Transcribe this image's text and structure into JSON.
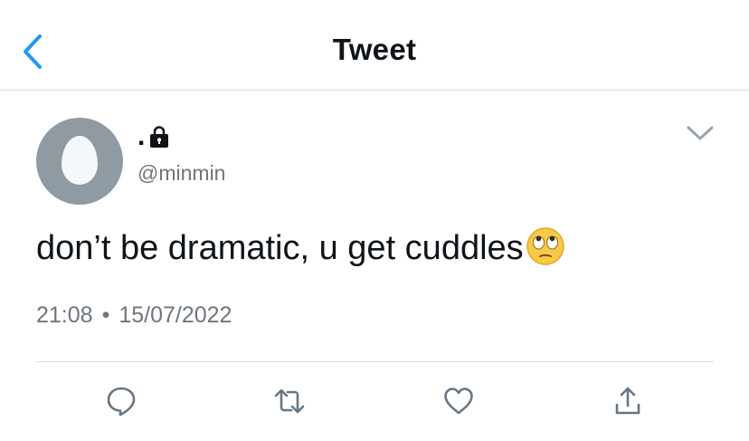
{
  "header": {
    "title": "Tweet",
    "back_icon": "chevron-left-icon",
    "accent": "#1d9bf0"
  },
  "tweet": {
    "display_name": ".",
    "protected_icon": "lock-icon",
    "handle": "@minmin",
    "text": "don’t be dramatic, u get cuddles",
    "emoji": "face-with-rolling-eyes",
    "time": "21:08",
    "separator": "•",
    "date": "15/07/2022",
    "more_icon": "chevron-down-icon"
  },
  "actions": [
    {
      "icon": "reply-icon"
    },
    {
      "icon": "retweet-icon"
    },
    {
      "icon": "like-icon"
    },
    {
      "icon": "share-icon"
    }
  ],
  "colors": {
    "text": "#0f1419",
    "secondary": "#6e767d",
    "icon": "#657786",
    "divider": "#d6d9dc"
  }
}
